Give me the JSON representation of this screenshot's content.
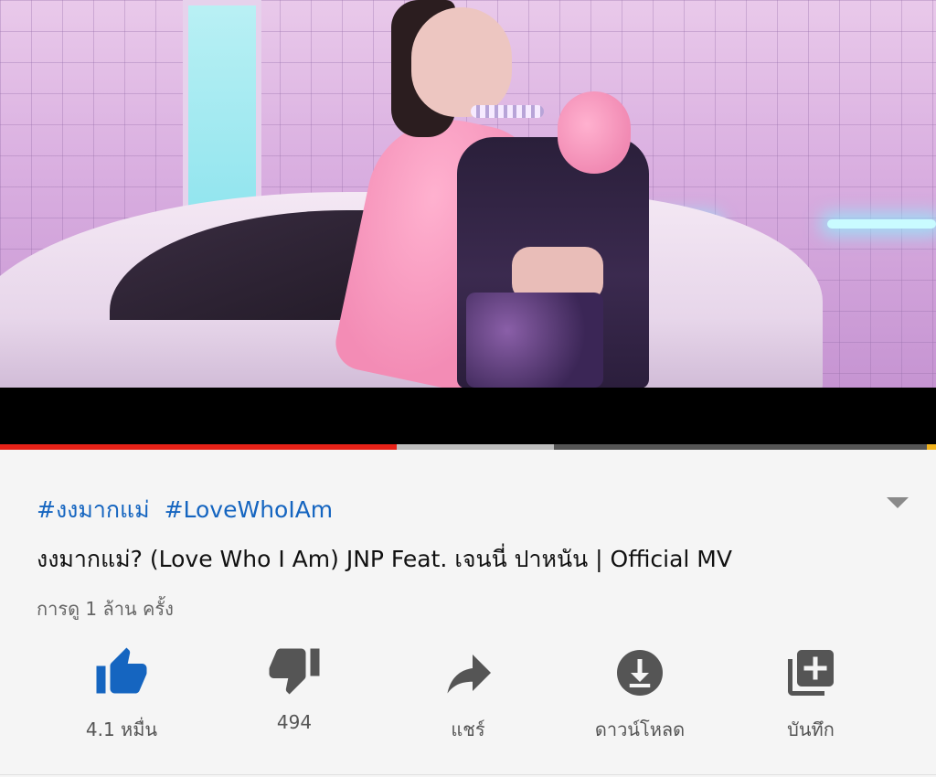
{
  "video": {
    "progress_played_fraction": 0.424,
    "progress_buffered_fraction": 0.592
  },
  "details": {
    "hashtags": [
      "#งงมากแม่",
      "#LoveWhoIAm"
    ],
    "title": "งงมากแม่? (Love Who I Am) JNP Feat. เจนนี่ ปาหนัน | Official MV",
    "views": "การดู 1 ล้าน ครั้ง",
    "expand_icon": "chevron-down-icon"
  },
  "actions": {
    "like": {
      "label": "4.1 หมื่น",
      "icon": "thumbs-up-icon",
      "color": "#1565c0"
    },
    "dislike": {
      "label": "494",
      "icon": "thumbs-down-icon",
      "color": "#555555"
    },
    "share": {
      "label": "แชร์",
      "icon": "share-icon",
      "color": "#555555"
    },
    "download": {
      "label": "ดาวน์โหลด",
      "icon": "download-icon",
      "color": "#555555"
    },
    "save": {
      "label": "บันทึก",
      "icon": "add-to-playlist-icon",
      "color": "#555555"
    }
  },
  "colors": {
    "link": "#1565c0",
    "progress_played": "#e62117"
  }
}
